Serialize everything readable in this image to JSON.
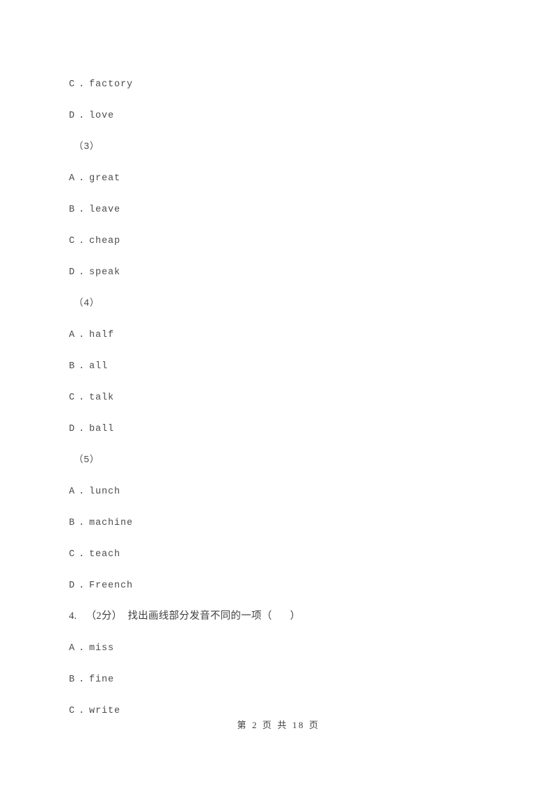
{
  "document": {
    "type": "exam-paper",
    "text_color": "#4d4d4d",
    "background_color": "#ffffff"
  },
  "body_lines": [
    {
      "kind": "option",
      "mark": "C",
      "dot": ".",
      "word": "factory"
    },
    {
      "kind": "option",
      "mark": "D",
      "dot": ".",
      "word": "love"
    },
    {
      "kind": "subquestion",
      "label": "（3）"
    },
    {
      "kind": "option",
      "mark": "A",
      "dot": ".",
      "word": "great"
    },
    {
      "kind": "option",
      "mark": "B",
      "dot": ".",
      "word": "leave"
    },
    {
      "kind": "option",
      "mark": "C",
      "dot": ".",
      "word": "cheap"
    },
    {
      "kind": "option",
      "mark": "D",
      "dot": ".",
      "word": "speak"
    },
    {
      "kind": "subquestion",
      "label": "（4）"
    },
    {
      "kind": "option",
      "mark": "A",
      "dot": ".",
      "word": "half"
    },
    {
      "kind": "option",
      "mark": "B",
      "dot": ".",
      "word": "all"
    },
    {
      "kind": "option",
      "mark": "C",
      "dot": ".",
      "word": "talk"
    },
    {
      "kind": "option",
      "mark": "D",
      "dot": ".",
      "word": "ball"
    },
    {
      "kind": "subquestion",
      "label": "（5）"
    },
    {
      "kind": "option",
      "mark": "A",
      "dot": ".",
      "word": "lunch"
    },
    {
      "kind": "option",
      "mark": "B",
      "dot": ".",
      "word": "machine"
    },
    {
      "kind": "option",
      "mark": "C",
      "dot": ".",
      "word": "teach"
    },
    {
      "kind": "option",
      "mark": "D",
      "dot": ".",
      "word": "Freench"
    }
  ],
  "question_4": {
    "number": "4.",
    "score": "（2分）",
    "prompt": "找出画线部分发音不同的一项（",
    "close": "）",
    "options": [
      {
        "mark": "A",
        "dot": ".",
        "word": "miss"
      },
      {
        "mark": "B",
        "dot": ".",
        "word": "fine"
      },
      {
        "mark": "C",
        "dot": ".",
        "word": "write"
      }
    ]
  },
  "footer": {
    "text": "第 2 页 共 18 页",
    "current_page": "2",
    "total_pages": "18"
  }
}
